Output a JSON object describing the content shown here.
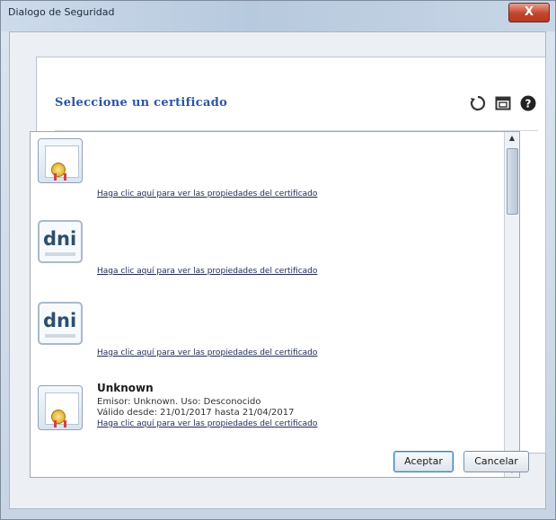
{
  "window": {
    "title": "Dialogo de Seguridad",
    "close_label": "X"
  },
  "panel": {
    "title": "Seleccione un certificado",
    "icons": [
      "refresh-icon",
      "window-icon",
      "help-icon"
    ]
  },
  "certificates": [
    {
      "icon": "certificate-icon",
      "name": "",
      "issuer": "",
      "validity": "",
      "link": "Haga clic aquí para ver las propiedades del certificado"
    },
    {
      "icon": "dni-icon",
      "name": "",
      "issuer": "",
      "validity": "",
      "link": "Haga clic aquí para ver las propiedades del certificado"
    },
    {
      "icon": "dni-icon",
      "name": "",
      "issuer": "",
      "validity": "",
      "link": "Haga clic aquí para ver las propiedades del certificado"
    },
    {
      "icon": "certificate-icon",
      "name": "Unknown",
      "issuer": "Emisor: Unknown. Uso: Desconocido",
      "validity": "Válido desde: 21/01/2017 hasta 21/04/2017",
      "link": "Haga clic aquí para ver las propiedades del certificado"
    }
  ],
  "dni_icon_text": "dni",
  "buttons": {
    "accept": "Aceptar",
    "cancel": "Cancelar"
  }
}
